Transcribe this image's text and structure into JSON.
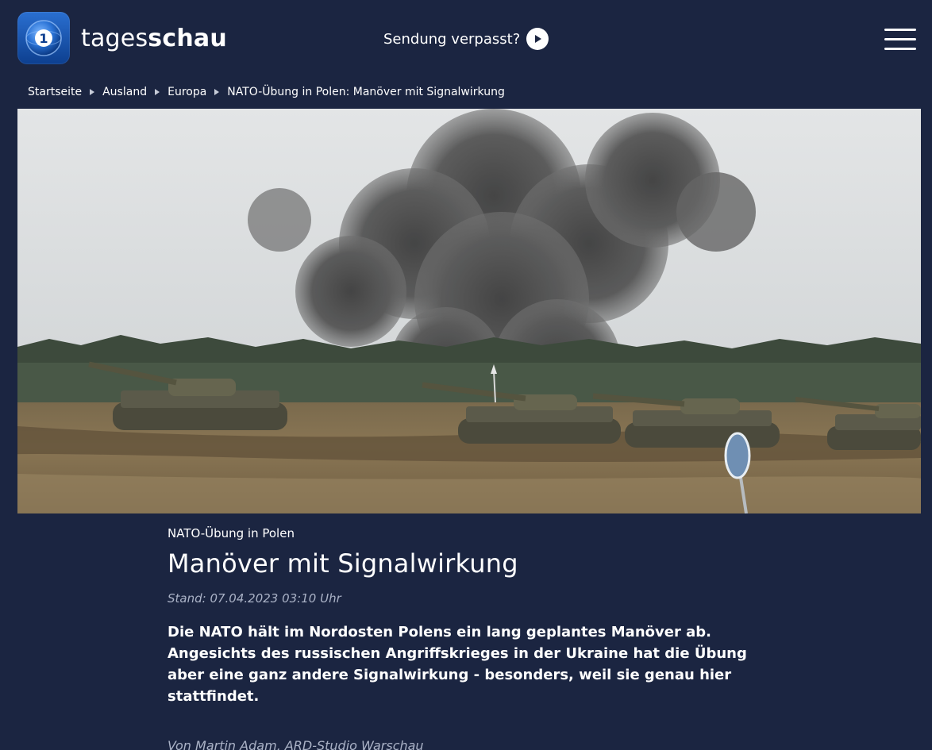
{
  "header": {
    "brand_regular": "tages",
    "brand_bold": "schau",
    "missed_label": "Sendung verpasst?",
    "logo_icon": "tagesschau-1-logo-icon",
    "play_icon": "play-circle-icon",
    "menu_icon": "hamburger-menu-icon"
  },
  "breadcrumb": {
    "items": [
      "Startseite",
      "Ausland",
      "Europa",
      "NATO-Übung in Polen: Manöver mit Signalwirkung"
    ],
    "separator_icon": "triangle-right-icon"
  },
  "article": {
    "topline": "NATO-Übung in Polen",
    "headline": "Manöver mit Signalwirkung",
    "stand": "Stand: 07.04.2023 03:10 Uhr",
    "lead": "Die NATO hält im Nordosten Polens ein lang geplantes Manöver ab. Angesichts des russischen Angriffskrieges in der Ukraine hat die Übung aber eine ganz andere Signalwirkung - besonders, weil sie genau hier stattfindet.",
    "author": "Von Martin Adam, ARD-Studio Warschau"
  },
  "colors": {
    "background": "#1b2541",
    "text": "#ffffff",
    "muted": "#aab2c6",
    "logo_blue": "#1a5bb8"
  }
}
